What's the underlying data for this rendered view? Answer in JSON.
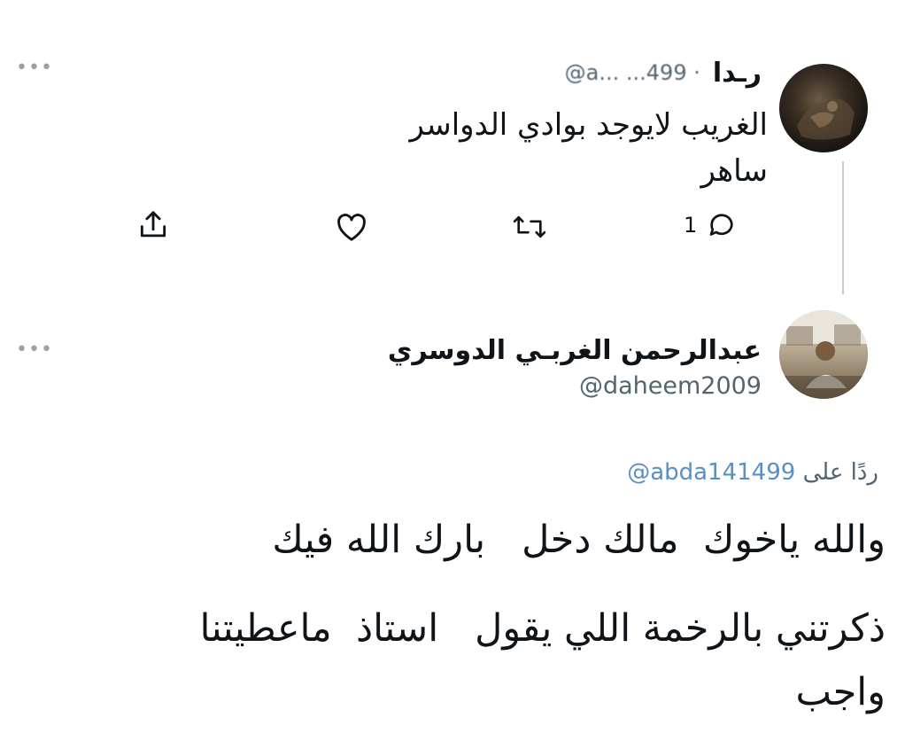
{
  "first_tweet": {
    "author_name": "رـدا",
    "handle_fragment": "@a...  ...499 ·",
    "text_line1": "الغريب لايوجد بوادي الدواسر",
    "text_line2": "ساهر",
    "more_icon": "more-horizontal",
    "actions": {
      "reply_count": "1",
      "reply_icon": "chat-bubble-icon",
      "retweet_icon": "retweet-icon",
      "like_icon": "heart-icon",
      "share_icon": "share-icon"
    }
  },
  "reply_tweet": {
    "author_name": "عبدالرحمن الغربـي الدوسري",
    "handle": "@daheem2009",
    "more_icon": "more-horizontal",
    "replying_to_prefix": "ردًا على",
    "replying_to_handle": "@abda141499",
    "text_line1": "والله ياخوك  مالك دخل   بارك الله فيك",
    "text_line2": "ذكرتني بالرخمة اللي يقول   استاذ  ماعطيتنا",
    "text_line3": "واجب"
  },
  "colors": {
    "text": "#0f1419",
    "muted": "#536471",
    "link": "#5a8fc4",
    "thread_line": "#c7ccd1"
  }
}
